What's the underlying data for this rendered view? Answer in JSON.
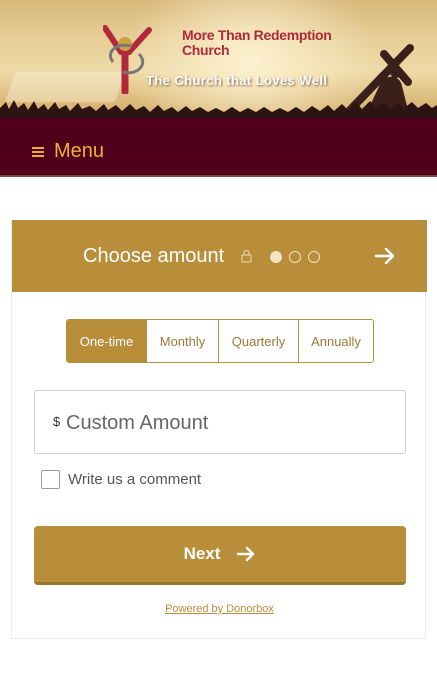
{
  "header": {
    "church_name_line1": "More Than Redemption",
    "church_name_line2": "Church",
    "tagline": "The Church that Loves Well"
  },
  "menu": {
    "label": "Menu"
  },
  "donation": {
    "title": "Choose amount",
    "step_current": 1,
    "step_total": 3,
    "frequencies": [
      "One-time",
      "Monthly",
      "Quarterly",
      "Annually"
    ],
    "selected_frequency": "One-time",
    "currency_symbol": "$",
    "amount_placeholder": "Custom Amount",
    "amount_value": "",
    "comment_label": "Write us a comment",
    "comment_checked": false,
    "next_label": "Next",
    "powered_by": "Powered by Donorbox"
  },
  "colors": {
    "brand_gold": "#b98e3a",
    "menu_bg": "#50001b",
    "menu_text": "#e8b33a",
    "church_red": "#b0283a"
  },
  "icons": {
    "menu": "hamburger-icon",
    "lock": "lock-icon",
    "next": "arrow-right-icon"
  }
}
